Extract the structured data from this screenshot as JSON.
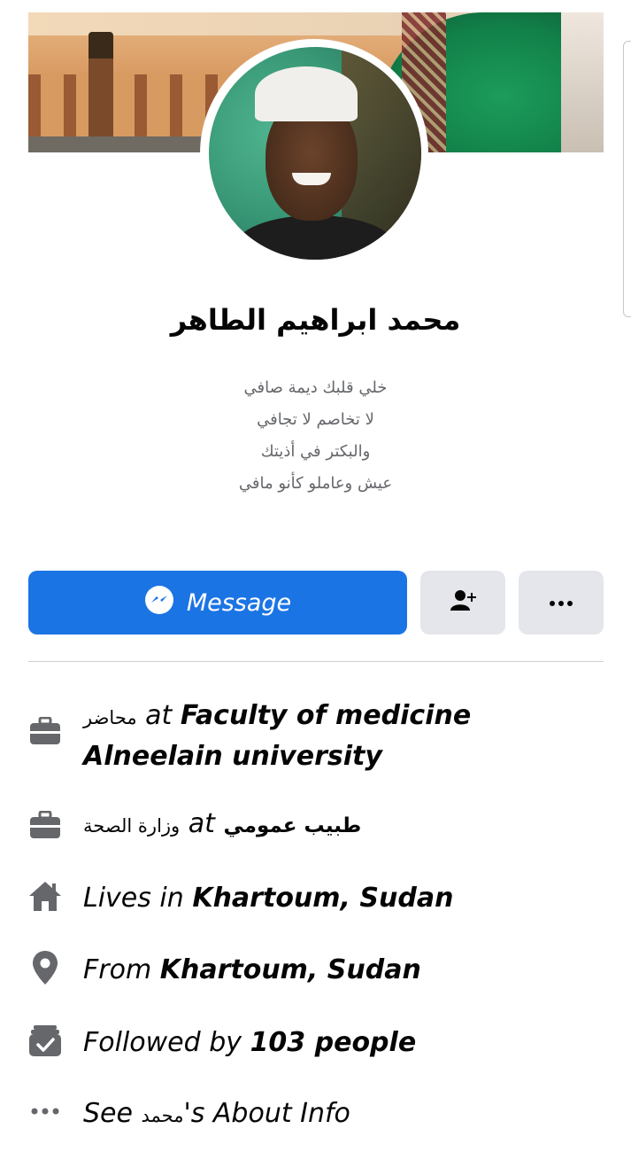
{
  "profile": {
    "name": "محمد ابراهيم الطاهر",
    "bio_lines": [
      "خلي قلبك ديمة صافي",
      "لا تخاصم لا تجافي",
      "والبكتر في أذيتك",
      "عيش وعاملو كأنو مافي"
    ]
  },
  "actions": {
    "message_label": "Message",
    "add_friend_icon": "add-friend-icon",
    "more_icon": "more-icon"
  },
  "details": {
    "work1": {
      "role": "محاضر",
      "at": "at",
      "place_line1": "Faculty of medicine",
      "place_line2": "Alneelain university"
    },
    "work2": {
      "role": "طبيب عمومي",
      "at": "at",
      "place": "وزارة الصحة"
    },
    "lives": {
      "prefix": "Lives in",
      "place": "Khartoum, Sudan"
    },
    "from": {
      "prefix": "From",
      "place": "Khartoum, Sudan"
    },
    "followed": {
      "prefix": "Followed by",
      "count": "103 people"
    },
    "about": {
      "prefix": "See",
      "name": "محمد",
      "suffix": "'s About Info"
    }
  },
  "colors": {
    "accent": "#1b74e4",
    "icon_gray": "#65676b",
    "button_gray": "#e4e6eb"
  }
}
